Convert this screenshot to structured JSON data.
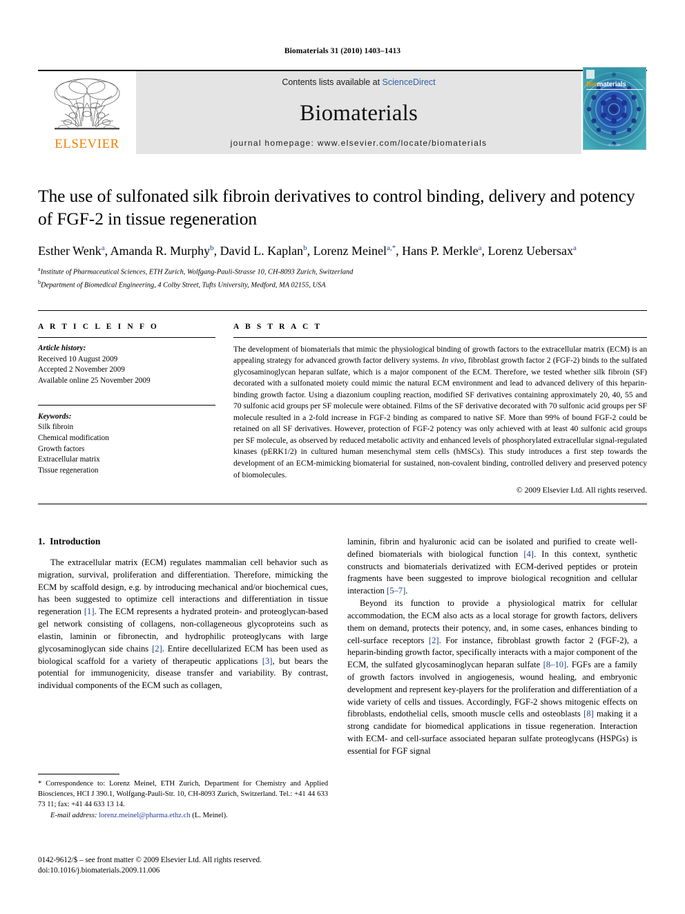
{
  "running_head": "Biomaterials 31 (2010) 1403–1413",
  "banner": {
    "publisher_name": "ELSEVIER",
    "contents_prefix": "Contents lists available at ",
    "contents_link": "ScienceDirect",
    "journal_name": "Biomaterials",
    "homepage": "journal homepage: www.elsevier.com/locate/biomaterials",
    "cover": {
      "title_first": "Bio",
      "title_rest": "materials",
      "footer": "ELSEVIER"
    }
  },
  "article": {
    "title": "The use of sulfonated silk fibroin derivatives to control binding, delivery and potency of FGF-2 in tissue regeneration",
    "authors": [
      {
        "name": "Esther Wenk",
        "sup": "a"
      },
      {
        "name": "Amanda R. Murphy",
        "sup": "b"
      },
      {
        "name": "David L. Kaplan",
        "sup": "b"
      },
      {
        "name": "Lorenz Meinel",
        "sup": "a,*"
      },
      {
        "name": "Hans P. Merkle",
        "sup": "a"
      },
      {
        "name": "Lorenz Uebersax",
        "sup": "a"
      }
    ],
    "affiliations": [
      {
        "mark": "a",
        "text": "Institute of Pharmaceutical Sciences, ETH Zurich, Wolfgang-Pauli-Strasse 10, CH-8093 Zurich, Switzerland"
      },
      {
        "mark": "b",
        "text": "Department of Biomedical Engineering, 4 Colby Street, Tufts University, Medford, MA 02155, USA"
      }
    ]
  },
  "article_info": {
    "heading": "A R T I C L E   I N F O",
    "history_label": "Article history:",
    "history": [
      "Received 10 August 2009",
      "Accepted 2 November 2009",
      "Available online 25 November 2009"
    ],
    "keywords_label": "Keywords:",
    "keywords": [
      "Silk fibroin",
      "Chemical modification",
      "Growth factors",
      "Extracellular matrix",
      "Tissue regeneration"
    ]
  },
  "abstract": {
    "heading": "A B S T R A C T",
    "part1": "The development of biomaterials that mimic the physiological binding of growth factors to the extracellular matrix (ECM) is an appealing strategy for advanced growth factor delivery systems. ",
    "italic1": "In vivo",
    "part2": ", fibroblast growth factor 2 (FGF-2) binds to the sulfated glycosaminoglycan heparan sulfate, which is a major component of the ECM. Therefore, we tested whether silk fibroin (SF) decorated with a sulfonated moiety could mimic the natural ECM environment and lead to advanced delivery of this heparin-binding growth factor. Using a diazonium coupling reaction, modified SF derivatives containing approximately 20, 40, 55 and 70 sulfonic acid groups per SF molecule were obtained. Films of the SF derivative decorated with 70 sulfonic acid groups per SF molecule resulted in a 2-fold increase in FGF-2 binding as compared to native SF. More than 99% of bound FGF-2 could be retained on all SF derivatives. However, protection of FGF-2 potency was only achieved with at least 40 sulfonic acid groups per SF molecule, as observed by reduced metabolic activity and enhanced levels of phosphorylated extracellular signal-regulated kinases (pERK1/2) in cultured human mesenchymal stem cells (hMSCs). This study introduces a first step towards the development of an ECM-mimicking biomaterial for sustained, non-covalent binding, controlled delivery and preserved potency of biomolecules.",
    "copyright": "© 2009 Elsevier Ltd. All rights reserved."
  },
  "section": {
    "number": "1.",
    "title": "Introduction"
  },
  "body": {
    "left_p1_a": "The extracellular matrix (ECM) regulates mammalian cell behavior such as migration, survival, proliferation and differentiation. Therefore, mimicking the ECM by scaffold design, e.g. by introducing mechanical and/or biochemical cues, has been suggested to optimize cell interactions and differentiation in tissue regeneration ",
    "left_p1_r1": "[1]",
    "left_p1_b": ". The ECM represents a hydrated protein- and proteoglycan-based gel network consisting of collagens, non-collageneous glycoproteins such as elastin, laminin or fibronectin, and hydrophilic proteoglycans with large glycosaminoglycan side chains ",
    "left_p1_r2": "[2]",
    "left_p1_c": ". Entire decellularized ECM has been used as biological scaffold for a variety of therapeutic applications ",
    "left_p1_r3": "[3]",
    "left_p1_d": ", but bears the potential for immunogenicity, disease transfer and variability. By contrast, individual components of the ECM such as collagen,",
    "right_p1_a": "laminin, fibrin and hyaluronic acid can be isolated and purified to create well-defined biomaterials with biological function ",
    "right_p1_r1": "[4]",
    "right_p1_b": ". In this context, synthetic constructs and biomaterials derivatized with ECM-derived peptides or protein fragments have been suggested to improve biological recognition and cellular interaction ",
    "right_p1_r2": "[5–7]",
    "right_p1_c": ".",
    "right_p2_a": "Beyond its function to provide a physiological matrix for cellular accommodation, the ECM also acts as a local storage for growth factors, delivers them on demand, protects their potency, and, in some cases, enhances binding to cell-surface receptors ",
    "right_p2_r1": "[2]",
    "right_p2_b": ". For instance, fibroblast growth factor 2 (FGF-2), a heparin-binding growth factor, specifically interacts with a major component of the ECM, the sulfated glycosaminoglycan heparan sulfate ",
    "right_p2_r2": "[8–10]",
    "right_p2_c": ". FGFs are a family of growth factors involved in angiogenesis, wound healing, and embryonic development and represent key-players for the proliferation and differentiation of a wide variety of cells and tissues. Accordingly, FGF-2 shows mitogenic effects on fibroblasts, endothelial cells, smooth muscle cells and osteoblasts ",
    "right_p2_r3": "[8]",
    "right_p2_d": " making it a strong candidate for biomedical applications in tissue regeneration. Interaction with ECM- and cell-surface associated heparan sulfate proteoglycans (HSPGs) is essential for FGF signal"
  },
  "footnote": {
    "correspondence": "* Correspondence to: Lorenz Meinel, ETH Zurich, Department for Chemistry and Applied Biosciences, HCI J 390.1, Wolfgang-Pauli-Str. 10, CH-8093 Zurich, Switzerland. Tel.: +41 44 633 73 11; fax: +41 44 633 13 14.",
    "email_label": "E-mail address:",
    "email": "lorenz.meinel@pharma.ethz.ch",
    "email_suffix": " (L. Meinel)."
  },
  "issn_line": {
    "line1": "0142-9612/$ – see front matter © 2009 Elsevier Ltd. All rights reserved.",
    "line2": "doi:10.1016/j.biomaterials.2009.11.006"
  },
  "colors": {
    "link": "#2f5fa8",
    "reference": "#22408f",
    "elsevier_orange": "#F08000",
    "banner_gray": "#e4e4e4"
  }
}
